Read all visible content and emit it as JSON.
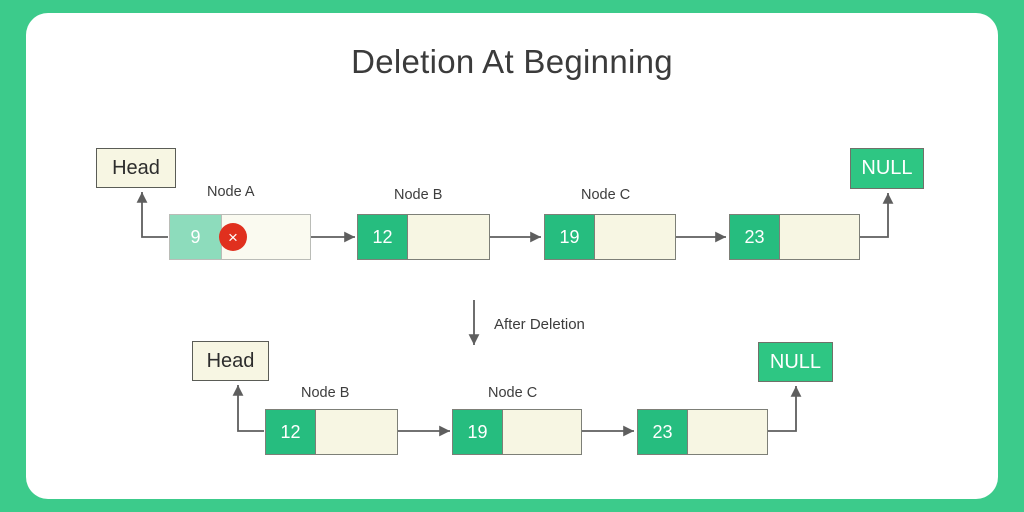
{
  "page": {
    "title": "Deletion At Beginning",
    "border_color": "#3ccb8b",
    "card_color": "#ffffff"
  },
  "colors": {
    "accent_green": "#26bd7f",
    "null_green": "#2ec683",
    "cream": "#f7f6e3",
    "delete_red": "#e0301e",
    "wire": "#5e5e5e",
    "border_gray": "#7d7f77"
  },
  "before": {
    "head_label": "Head",
    "null_label": "NULL",
    "delete_marker": "×",
    "nodes": [
      {
        "caption": "Node A",
        "value": "9",
        "deleted": true
      },
      {
        "caption": "Node B",
        "value": "12",
        "deleted": false
      },
      {
        "caption": "Node C",
        "value": "19",
        "deleted": false
      },
      {
        "caption": "",
        "value": "23",
        "deleted": false
      }
    ]
  },
  "transition": {
    "label": "After Deletion"
  },
  "after": {
    "head_label": "Head",
    "null_label": "NULL",
    "nodes": [
      {
        "caption": "Node B",
        "value": "12"
      },
      {
        "caption": "Node C",
        "value": "19"
      },
      {
        "caption": "",
        "value": "23"
      }
    ]
  }
}
